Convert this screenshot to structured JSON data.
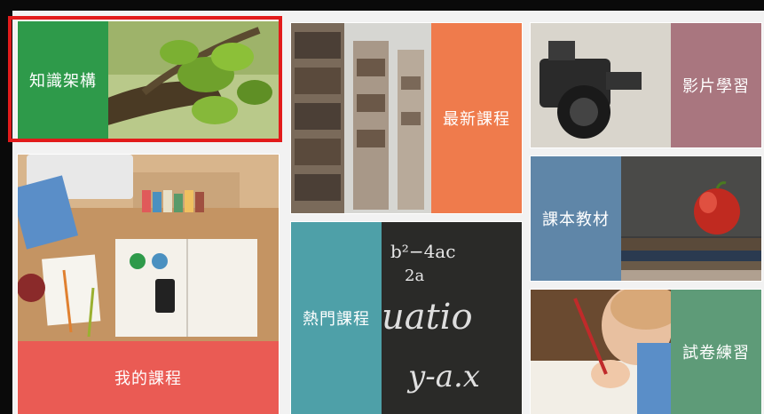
{
  "tiles": {
    "knowledge": {
      "label": "知識架構",
      "color": "#2e9a4a"
    },
    "latest": {
      "label": "最新課程",
      "color": "#ef7b4c"
    },
    "video": {
      "label": "影片學習",
      "color": "#a9767f"
    },
    "my_courses": {
      "label": "我的課程",
      "color": "#ea5b54"
    },
    "textbook": {
      "label": "課本教材",
      "color": "#5f86a8"
    },
    "popular": {
      "label": "熱門課程",
      "color": "#4ea0a8"
    },
    "exam": {
      "label": "試卷練習",
      "color": "#5e9b78"
    }
  },
  "chalkboard": {
    "line1": "b²−4ac",
    "line2": "2a",
    "line3": "uatio",
    "line4": "y-a.x"
  },
  "colors": {
    "selection": "#e21b1b"
  }
}
